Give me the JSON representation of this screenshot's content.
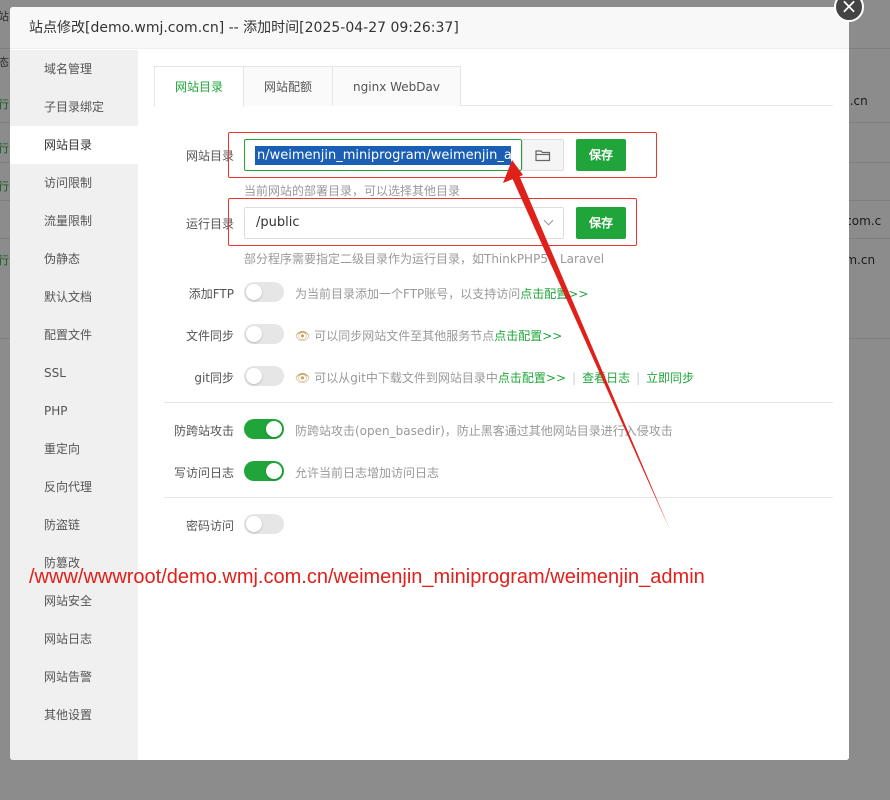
{
  "background": {
    "left_fragments": [
      {
        "text": "站",
        "gray": true
      },
      {
        "text": "态",
        "gray": true
      },
      {
        "text": "行",
        "gray": false
      },
      {
        "text": "行",
        "gray": false
      },
      {
        "text": "行",
        "gray": false
      },
      {
        "text": "行",
        "gray": false
      }
    ],
    "right_fragments": [
      "m.cn",
      "n",
      "j.com.c",
      "om.cn"
    ]
  },
  "modal": {
    "title": "站点修改[demo.wmj.com.cn] -- 添加时间[2025-04-27 09:26:37]",
    "close_glyph": "×"
  },
  "sidebar": {
    "items": [
      {
        "label": "域名管理",
        "active": false
      },
      {
        "label": "子目录绑定",
        "active": false
      },
      {
        "label": "网站目录",
        "active": true
      },
      {
        "label": "访问限制",
        "active": false
      },
      {
        "label": "流量限制",
        "active": false
      },
      {
        "label": "伪静态",
        "active": false
      },
      {
        "label": "默认文档",
        "active": false
      },
      {
        "label": "配置文件",
        "active": false
      },
      {
        "label": "SSL",
        "active": false
      },
      {
        "label": "PHP",
        "active": false
      },
      {
        "label": "重定向",
        "active": false
      },
      {
        "label": "反向代理",
        "active": false
      },
      {
        "label": "防盗链",
        "active": false
      },
      {
        "label": "防篡改",
        "active": false
      },
      {
        "label": "网站安全",
        "active": false
      },
      {
        "label": "网站日志",
        "active": false
      },
      {
        "label": "网站告警",
        "active": false
      },
      {
        "label": "其他设置",
        "active": false
      }
    ]
  },
  "tabs": [
    "网站目录",
    "网站配额",
    "nginx WebDav"
  ],
  "site_dir": {
    "label": "网站目录",
    "value": "n/weimenjin_miniprogram/weimenjin_admin",
    "save": "保存",
    "hint": "当前网站的部署目录，可以选择其他目录"
  },
  "run_dir": {
    "label": "运行目录",
    "value": "/public",
    "save": "保存",
    "hint": "部分程序需要指定二级目录作为运行目录，如ThinkPHP5，Laravel"
  },
  "ftp": {
    "label": "添加FTP",
    "on": false,
    "desc": "为当前目录添加一个FTP账号，以支持访问",
    "link": "点击配置>>"
  },
  "file_sync": {
    "label": "文件同步",
    "on": false,
    "desc": "可以同步网站文件至其他服务节点",
    "link": "点击配置>>"
  },
  "git_sync": {
    "label": "git同步",
    "on": false,
    "desc": "可以从git中下载文件到网站目录中",
    "link": "点击配置>>",
    "log_link": "查看日志",
    "sync_link": "立即同步"
  },
  "anti_xss": {
    "label": "防跨站攻击",
    "on": true,
    "desc": "防跨站攻击(open_basedir)，防止黑客通过其他网站目录进行入侵攻击"
  },
  "access_log": {
    "label": "写访问日志",
    "on": true,
    "desc": "允许当前日志增加访问日志"
  },
  "password_access": {
    "label": "密码访问",
    "on": false
  },
  "annotation": {
    "text": "/www/wwwroot/demo.wmj.com.cn/weimenjin_miniprogram/weimenjin_admin",
    "color": "#e0201a"
  },
  "colors": {
    "accent": "#20a53a",
    "annotation": "#e0201a",
    "selection": "#1a5fb4"
  }
}
